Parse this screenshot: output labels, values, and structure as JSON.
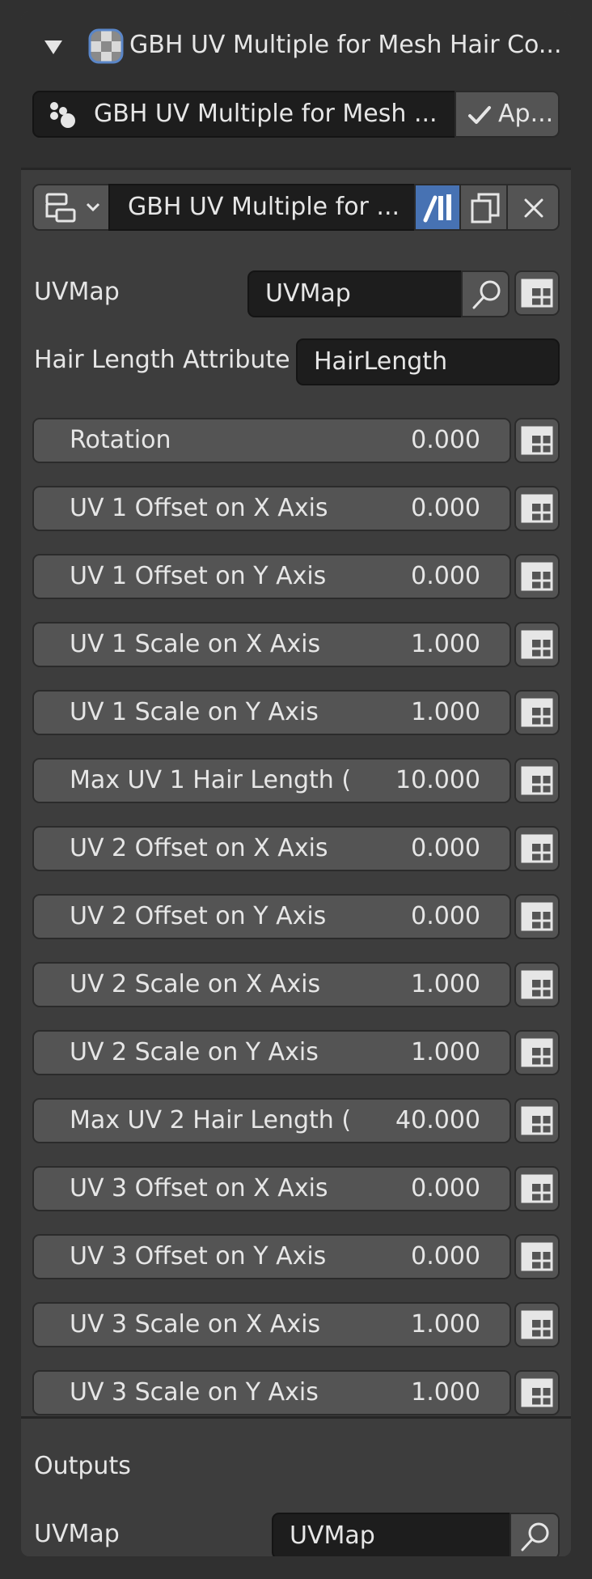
{
  "header": {
    "title": "GBH UV Multiple for Mesh Hair Co...",
    "modifier_name": "GBH UV Multiple for Mesh ...",
    "apply_label": "Ap..."
  },
  "toolbar": {
    "node_group_name": "GBH UV Multiple for ..."
  },
  "inputs": {
    "uvmap_label": "UVMap",
    "uvmap_value": "UVMap",
    "hair_length_label": "Hair Length Attribute",
    "hair_length_value": "HairLength"
  },
  "params": [
    {
      "label": "Rotation",
      "value": "0.000"
    },
    {
      "label": "UV 1 Offset on X Axis",
      "value": "0.000"
    },
    {
      "label": "UV 1 Offset on Y Axis",
      "value": "0.000"
    },
    {
      "label": "UV 1 Scale on X Axis",
      "value": "1.000"
    },
    {
      "label": "UV 1 Scale on Y Axis",
      "value": "1.000"
    },
    {
      "label": "Max UV 1 Hair Length (...",
      "value": "10.000"
    },
    {
      "label": "UV 2 Offset on X Axis",
      "value": "0.000"
    },
    {
      "label": "UV 2 Offset on Y Axis",
      "value": "0.000"
    },
    {
      "label": "UV 2 Scale on X Axis",
      "value": "1.000"
    },
    {
      "label": "UV 2 Scale on Y Axis",
      "value": "1.000"
    },
    {
      "label": "Max UV 2 Hair Length (...",
      "value": "40.000"
    },
    {
      "label": "UV 3 Offset on X Axis",
      "value": "0.000"
    },
    {
      "label": "UV 3 Offset on Y Axis",
      "value": "0.000"
    },
    {
      "label": "UV 3 Scale on X Axis",
      "value": "1.000"
    },
    {
      "label": "UV 3 Scale on Y Axis",
      "value": "1.000"
    }
  ],
  "outputs": {
    "heading": "Outputs",
    "uvmap_label": "UVMap",
    "uvmap_value": "UVMap"
  },
  "colors": {
    "panel": "#3d3d3d",
    "field": "#1d1d1d",
    "slider": "#545454",
    "accent": "#4772b3"
  },
  "icons": {
    "expand": "triangle-down-icon",
    "modifier": "checker-texture-icon",
    "particles": "particles-icon",
    "apply": "checkmark-icon",
    "node_tree": "node-tree-icon",
    "pin": "bar-chart-icon",
    "duplicate": "duplicate-icon",
    "close": "close-icon",
    "search": "search-icon",
    "attribute_toggle": "spreadsheet-icon"
  }
}
